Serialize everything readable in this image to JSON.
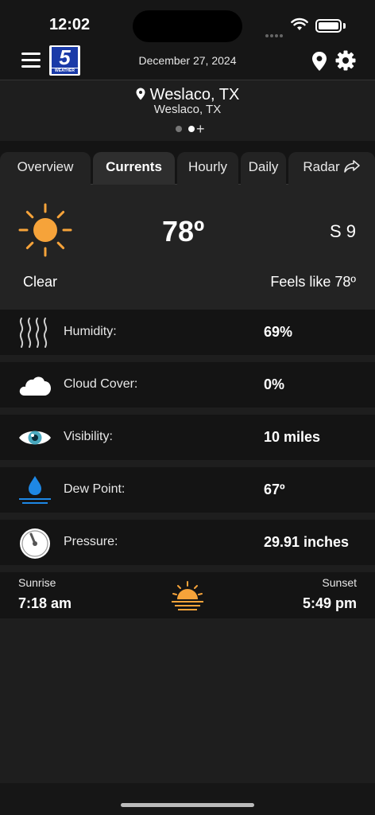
{
  "status": {
    "time": "12:02"
  },
  "header": {
    "date": "December 27, 2024",
    "logo_number": "5",
    "logo_text": "WEATHER"
  },
  "location": {
    "title": "Weslaco, TX",
    "subtitle": "Weslaco, TX",
    "add": "+"
  },
  "tabs": [
    {
      "label": "Overview"
    },
    {
      "label": "Currents",
      "active": true
    },
    {
      "label": "Hourly"
    },
    {
      "label": "Daily"
    },
    {
      "label": "Radar"
    }
  ],
  "current": {
    "temperature": "78º",
    "wind": "S 9",
    "condition": "Clear",
    "feels_like": "Feels like 78º"
  },
  "details": [
    {
      "icon": "humidity-icon",
      "label": "Humidity:",
      "value": "69%"
    },
    {
      "icon": "cloud-icon",
      "label": "Cloud Cover:",
      "value": "0%"
    },
    {
      "icon": "eye-icon",
      "label": "Visibility:",
      "value": "10 miles"
    },
    {
      "icon": "water-drop-icon",
      "label": "Dew Point:",
      "value": "67º"
    },
    {
      "icon": "gauge-icon",
      "label": "Pressure:",
      "value": "29.91 inches"
    }
  ],
  "sun": {
    "sunrise_label": "Sunrise",
    "sunrise_time": "7:18 am",
    "sunset_label": "Sunset",
    "sunset_time": "5:49 pm"
  },
  "colors": {
    "sun": "#f6a33a",
    "drop": "#1e88e5",
    "background": "#1e1e1e"
  }
}
